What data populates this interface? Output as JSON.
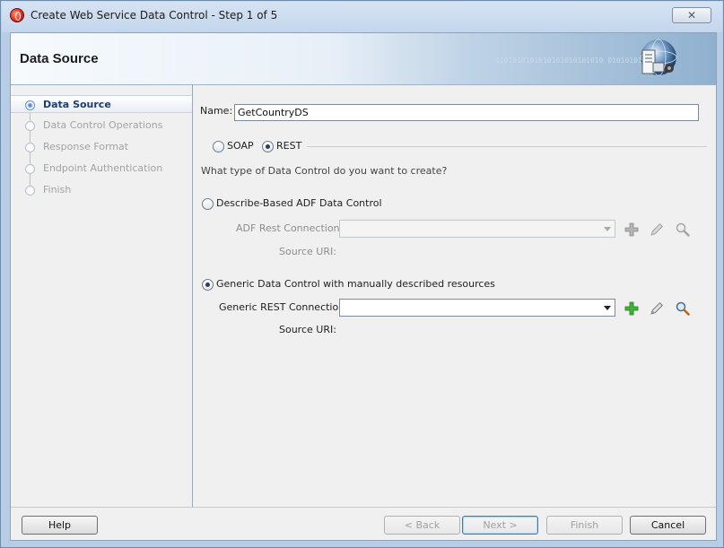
{
  "window": {
    "title": "Create Web Service Data Control - Step 1 of 5",
    "close_glyph": "✕"
  },
  "header": {
    "title": "Data Source",
    "binary_decoration": "0101010101010101010101010 01010101010"
  },
  "nav": {
    "items": [
      {
        "label": "Data Source",
        "state": "active"
      },
      {
        "label": "Data Control Operations",
        "state": "disabled"
      },
      {
        "label": "Response Format",
        "state": "disabled"
      },
      {
        "label": "Endpoint Authentication",
        "state": "disabled"
      },
      {
        "label": "Finish",
        "state": "disabled"
      }
    ]
  },
  "form": {
    "name_label": "Name:",
    "name_value": "GetCountryDS",
    "protocol": {
      "soap_label": "SOAP",
      "rest_label": "REST",
      "selected": "REST"
    },
    "question": "What type of Data Control do you want to create?",
    "describe_based": {
      "label": "Describe-Based ADF Data Control",
      "selected": false,
      "connection_label": "ADF Rest Connection:",
      "connection_value": "",
      "source_uri_label": "Source URI:"
    },
    "generic": {
      "label": "Generic Data Control with manually described resources",
      "selected": true,
      "connection_label": "Generic REST Connection:",
      "connection_value": "",
      "source_uri_label": "Source URI:"
    }
  },
  "icons": {
    "add": "plus-icon",
    "edit": "pencil-icon",
    "browse": "magnifier-icon",
    "add_color": "#2fa22b"
  },
  "footer": {
    "help": "Help",
    "back": "< Back",
    "next": "Next >",
    "finish": "Finish",
    "cancel": "Cancel"
  }
}
